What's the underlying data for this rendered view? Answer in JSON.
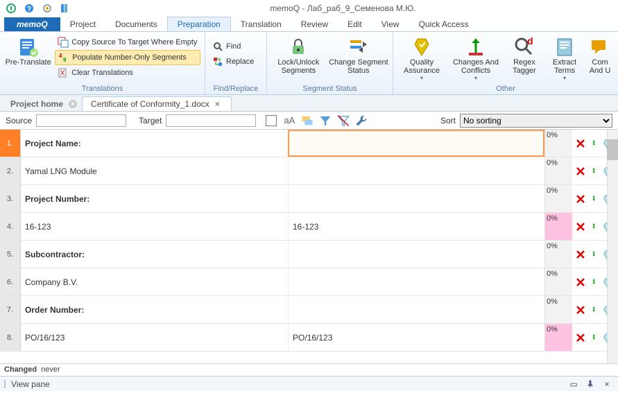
{
  "window_title": "memoQ - Лаб_раб_9_Семенова М.Ю.",
  "app_tab": "memoQ",
  "menu_tabs": [
    "Project",
    "Documents",
    "Preparation",
    "Translation",
    "Review",
    "Edit",
    "View",
    "Quick Access"
  ],
  "active_menu_tab": "Preparation",
  "ribbon": {
    "groups": {
      "translations": {
        "label": "Translations",
        "pretranslate": "Pre-Translate",
        "copy_empty": "Copy Source To Target Where Empty",
        "populate_numbers": "Populate Number-Only Segments",
        "clear": "Clear Translations"
      },
      "findreplace": {
        "label": "Find/Replace",
        "find": "Find",
        "replace": "Replace"
      },
      "segmentstatus": {
        "label": "Segment Status",
        "lock": "Lock/Unlock\nSegments",
        "change": "Change Segment\nStatus"
      },
      "other": {
        "label": "Other",
        "qa": "Quality\nAssurance",
        "changes": "Changes And\nConflicts",
        "regex": "Regex\nTagger",
        "extract": "Extract\nTerms",
        "comments": "Com\nAnd U"
      }
    }
  },
  "doc_tabs": {
    "home": "Project home",
    "active": "Certificate of Conformity_1.docx"
  },
  "filter": {
    "source_lbl": "Source",
    "target_lbl": "Target",
    "sort_lbl": "Sort",
    "sort_sel": "No sorting"
  },
  "segments": [
    {
      "n": "1.",
      "src": "Project Name:",
      "tgt": "",
      "pct": "0%",
      "bold": true,
      "active": true,
      "pink": false
    },
    {
      "n": "2.",
      "src": "Yamal LNG Module",
      "tgt": "",
      "pct": "0%",
      "bold": false,
      "active": false,
      "pink": false
    },
    {
      "n": "3.",
      "src": "Project Number:",
      "tgt": "",
      "pct": "0%",
      "bold": true,
      "active": false,
      "pink": false
    },
    {
      "n": "4.",
      "src": "16-123",
      "tgt": "16-123",
      "pct": "0%",
      "bold": false,
      "active": false,
      "pink": true
    },
    {
      "n": "5.",
      "src": "Subcontractor:",
      "tgt": "",
      "pct": "0%",
      "bold": true,
      "active": false,
      "pink": false
    },
    {
      "n": "6.",
      "src": "Company B.V.",
      "tgt": "",
      "pct": "0%",
      "bold": false,
      "active": false,
      "pink": false
    },
    {
      "n": "7.",
      "src": "Order Number:",
      "tgt": "",
      "pct": "0%",
      "bold": true,
      "active": false,
      "pink": false
    },
    {
      "n": "8.",
      "src": "PO/16/123",
      "tgt": "PO/16/123",
      "pct": "0%",
      "bold": false,
      "active": false,
      "pink": true
    }
  ],
  "status": {
    "changed_lbl": "Changed",
    "changed_val": "never"
  },
  "viewpane": "View pane"
}
